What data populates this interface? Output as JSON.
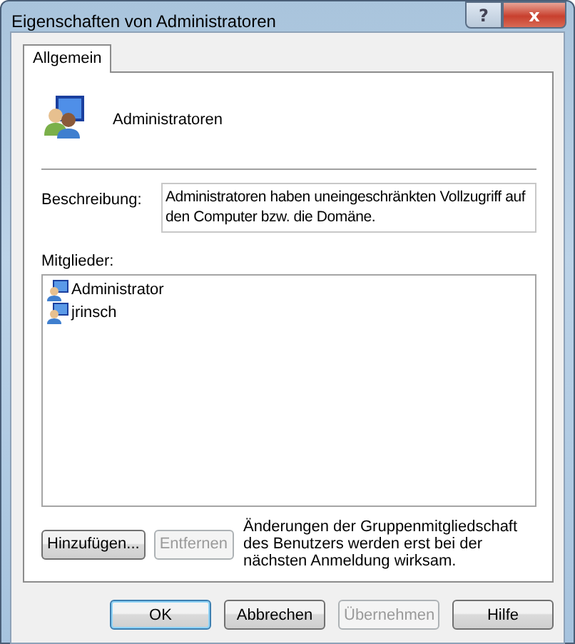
{
  "window": {
    "title": "Eigenschaften von Administratoren",
    "caption_buttons": [
      {
        "kind": "help",
        "label": "?"
      },
      {
        "kind": "close",
        "label": "x"
      }
    ]
  },
  "tabs": [
    {
      "label": "Allgemein",
      "selected": true
    }
  ],
  "group": {
    "name": "Administratoren"
  },
  "description": {
    "label": "Beschreibung:",
    "value": "Administratoren haben uneingeschränkten Vollzugriff auf den Computer bzw. die Domäne."
  },
  "members": {
    "label": "Mitglieder:",
    "items": [
      {
        "name": "Administrator",
        "selected": false
      },
      {
        "name": "jrinsch",
        "selected": false
      }
    ]
  },
  "member_buttons": [
    {
      "label": "Hinzufügen...",
      "disabled": false
    },
    {
      "label": "Entfernen",
      "disabled": true
    }
  ],
  "note": "Änderungen der Gruppenmitgliedschaft des Benutzers werden erst bei der nächsten Anmeldung wirksam.",
  "buttons": [
    {
      "label": "OK",
      "disabled": false,
      "default": true
    },
    {
      "label": "Abbrechen",
      "disabled": false,
      "default": false
    },
    {
      "label": "Übernehmen",
      "disabled": true,
      "default": false
    },
    {
      "label": "Hilfe",
      "disabled": false,
      "default": false
    }
  ]
}
